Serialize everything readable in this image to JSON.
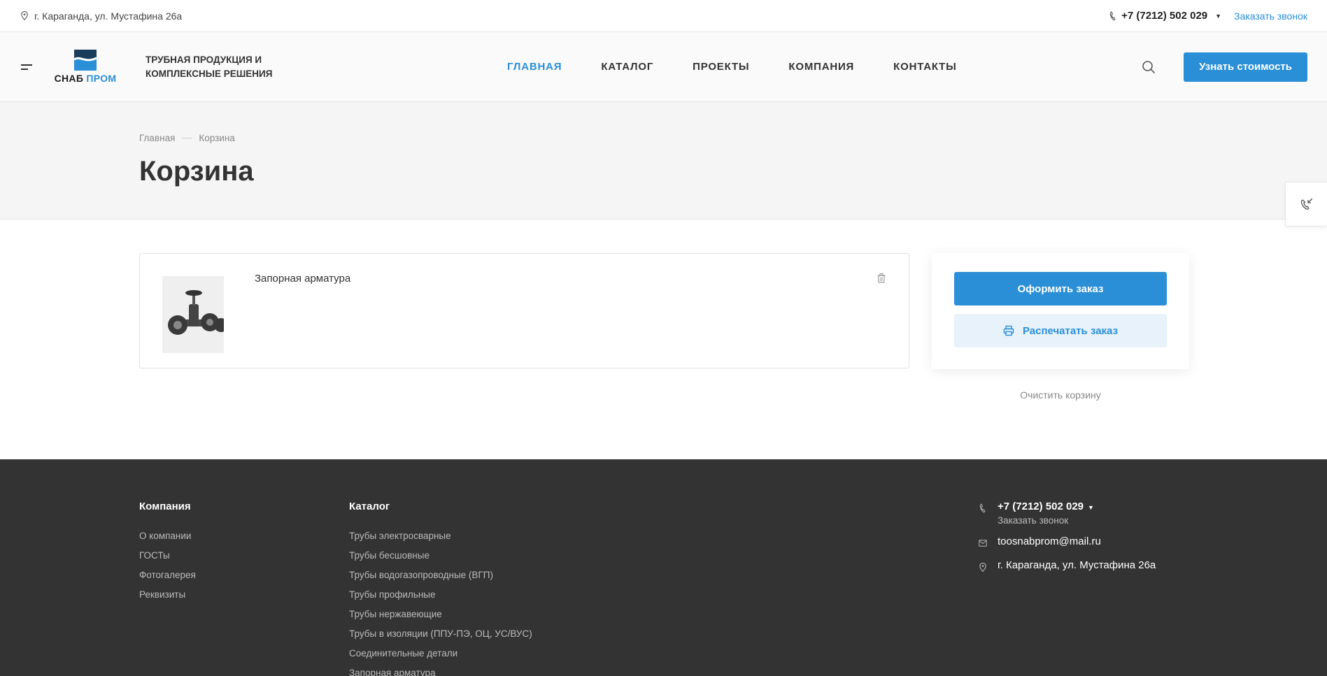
{
  "topbar": {
    "address": "г. Караганда, ул. Мустафина 26а",
    "phone": "+7 (7212) 502 029",
    "callback": "Заказать звонок"
  },
  "header": {
    "logo_part1": "СНАБ",
    "logo_part2": "ПРОМ",
    "slogan_line1": "ТРУБНАЯ ПРОДУКЦИЯ И",
    "slogan_line2": "КОМПЛЕКСНЫЕ РЕШЕНИЯ",
    "nav": [
      {
        "label": "ГЛАВНАЯ",
        "active": true
      },
      {
        "label": "КАТАЛОГ",
        "active": false
      },
      {
        "label": "ПРОЕКТЫ",
        "active": false
      },
      {
        "label": "КОМПАНИЯ",
        "active": false
      },
      {
        "label": "КОНТАКТЫ",
        "active": false
      }
    ],
    "cta_label": "Узнать стоимость"
  },
  "breadcrumbs": [
    "Главная",
    "Корзина"
  ],
  "page_title": "Корзина",
  "basket": {
    "items": [
      {
        "name": "Запорная арматура"
      }
    ],
    "order_button": "Оформить заказ",
    "print_button": "Распечатать заказ",
    "clear_link": "Очистить корзину"
  },
  "footer": {
    "company": {
      "title": "Компания",
      "links": [
        "О компании",
        "ГОСТы",
        "Фотогалерея",
        "Реквизиты"
      ]
    },
    "catalog": {
      "title": "Каталог",
      "links": [
        "Трубы электросварные",
        "Трубы бесшовные",
        "Трубы водогазопроводные (ВГП)",
        "Трубы профильные",
        "Трубы нержавеющие",
        "Трубы в изоляции (ППУ-ПЭ, ОЦ, УС/ВУС)",
        "Соединительные детали",
        "Запорная арматура"
      ]
    },
    "contacts": {
      "phone": "+7 (7212) 502 029",
      "callback": "Заказать звонок",
      "email": "toosnabprom@mail.ru",
      "address": "г. Караганда, ул. Мустафина 26а"
    }
  },
  "colors": {
    "accent": "#2a8fd6",
    "footer_bg": "#333333",
    "light_bg": "#f5f5f5"
  }
}
